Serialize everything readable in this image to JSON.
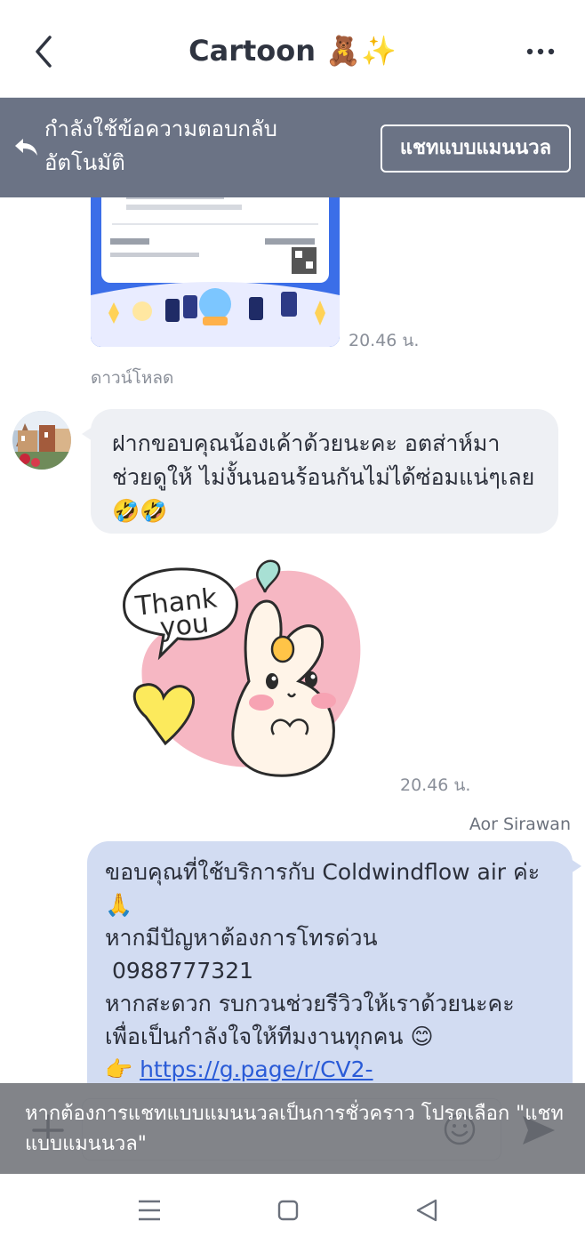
{
  "header": {
    "title": "Cartoon 🧸✨"
  },
  "banner": {
    "text": "กำลังใช้ข้อความตอบกลับอัตโนมัติ",
    "button_label": "แชทแบบแมนนวล"
  },
  "messages": {
    "image_time": "20.46 น.",
    "download_label": "ดาวน์โหลด",
    "incoming_text": "ฝากขอบคุณน้องเค้าด้วยนะคะ อตส่าห์มาช่วยดูให้ ไม่งั้นนอนร้อนกันไม่ได้ซ่อมแน่ๆเลย🤣🤣",
    "sticker_text_1": "Thank",
    "sticker_text_2": "you",
    "sticker_time": "20.46 น.",
    "sender_name": "Aor Sirawan",
    "outgoing_lines": [
      "ขอบคุณที่ใช้บริการกับ Coldwindflow air ค่ะ 🙏",
      "หากมีปัญหาต้องการโทรด่วน",
      " 0988777321",
      "หากสะดวก รบกวนช่วยรีวิวให้เราด้วยนะคะ เพื่อเป็นกำลังใจให้ทีมงานทุกคน 😊"
    ],
    "outgoing_link_prefix": "👉 ",
    "outgoing_link": "https://g.page/r/CV2-"
  },
  "toast": {
    "text": "หากต้องการแชทแบบแมนนวลเป็นการชั่วคราว โปรดเลือก \"แชทแบบแมนนวล\""
  },
  "colors": {
    "banner_bg": "#6b7385",
    "incoming_bubble": "#eef0f4",
    "outgoing_bubble": "#d2dcf2",
    "link": "#2a5bd7"
  }
}
